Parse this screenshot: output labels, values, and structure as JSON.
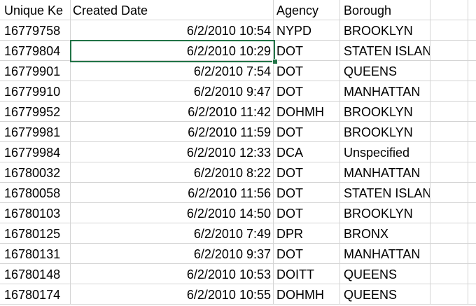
{
  "columns": [
    "Unique Ke",
    "Created Date",
    "Agency",
    "Borough"
  ],
  "rows": [
    [
      "16779758",
      "6/2/2010 10:54",
      "NYPD",
      "BROOKLYN"
    ],
    [
      "16779804",
      "6/2/2010 10:29",
      "DOT",
      "STATEN ISLAND"
    ],
    [
      "16779901",
      "6/2/2010 7:54",
      "DOT",
      "QUEENS"
    ],
    [
      "16779910",
      "6/2/2010 9:47",
      "DOT",
      "MANHATTAN"
    ],
    [
      "16779952",
      "6/2/2010 11:42",
      "DOHMH",
      "BROOKLYN"
    ],
    [
      "16779981",
      "6/2/2010 11:59",
      "DOT",
      "BROOKLYN"
    ],
    [
      "16779984",
      "6/2/2010 12:33",
      "DCA",
      "Unspecified"
    ],
    [
      "16780032",
      "6/2/2010 8:22",
      "DOT",
      "MANHATTAN"
    ],
    [
      "16780058",
      "6/2/2010 11:56",
      "DOT",
      "STATEN ISLAND"
    ],
    [
      "16780103",
      "6/2/2010 14:50",
      "DOT",
      "BROOKLYN"
    ],
    [
      "16780125",
      "6/2/2010 7:49",
      "DPR",
      "BRONX"
    ],
    [
      "16780131",
      "6/2/2010 9:37",
      "DOT",
      "MANHATTAN"
    ],
    [
      "16780148",
      "6/2/2010 10:53",
      "DOITT",
      "QUEENS"
    ],
    [
      "16780174",
      "6/2/2010 10:55",
      "DOHMH",
      "QUEENS"
    ]
  ],
  "selection": {
    "row": 1,
    "col": 1
  },
  "colors": {
    "selection": "#217346",
    "gridline": "#d4d4d4"
  }
}
